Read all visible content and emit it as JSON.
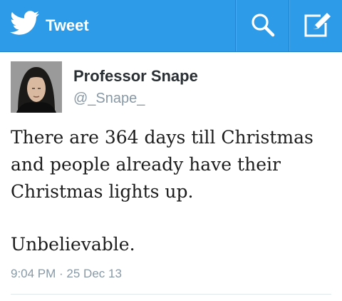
{
  "header": {
    "title": "Tweet",
    "logo_icon": "twitter-bird-icon",
    "search_icon": "search-icon",
    "compose_icon": "compose-icon",
    "bar_color": "#2d9be7"
  },
  "tweet": {
    "author_name": "Professor Snape",
    "author_handle": "@_Snape_",
    "text_lines": [
      "There are 364 days till Christmas",
      "and people already have their",
      "Christmas lights up."
    ],
    "text_tail": "Unbelievable.",
    "timestamp": "9:04 PM · 25 Dec 13"
  }
}
